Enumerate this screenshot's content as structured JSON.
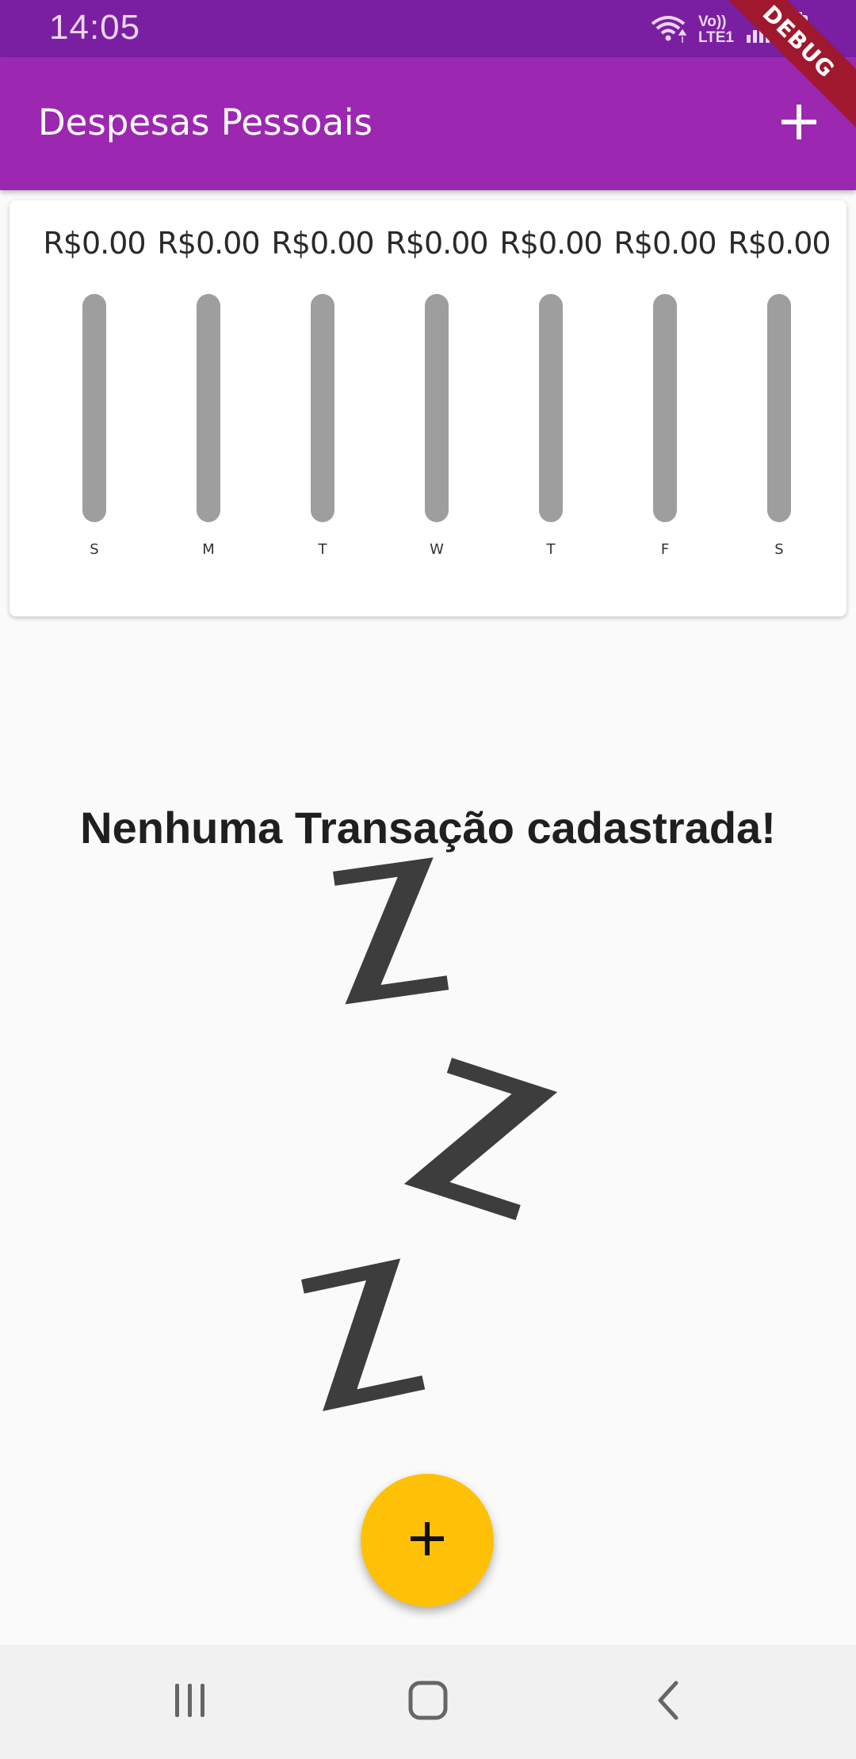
{
  "status_bar": {
    "time": "14:05",
    "network_label": "Vo))\nLTE1",
    "icons": [
      "wifi-icon",
      "signal-icon",
      "battery-charging-icon"
    ]
  },
  "debug_banner": {
    "label": "DEBUG"
  },
  "app_bar": {
    "title": "Despesas Pessoais",
    "add_icon": "plus-icon"
  },
  "chart_data": {
    "type": "bar",
    "categories": [
      "S",
      "M",
      "T",
      "W",
      "T",
      "F",
      "S"
    ],
    "values": [
      0,
      0,
      0,
      0,
      0,
      0,
      0
    ],
    "value_labels": [
      "R$0.00",
      "R$0.00",
      "R$0.00",
      "R$0.00",
      "R$0.00",
      "R$0.00",
      "R$0.00"
    ],
    "title": "",
    "xlabel": "",
    "ylabel": ""
  },
  "empty_state": {
    "message": "Nenhuma Transação cadastrada!",
    "illustration": "zzz-sleep-icon"
  },
  "fab": {
    "icon": "plus-icon"
  },
  "nav_bar": {
    "icons": [
      "recent-apps-icon",
      "home-icon",
      "back-icon"
    ]
  },
  "colors": {
    "primary": "#9c27b0",
    "status_bar": "#7b1fa2",
    "accent": "#ffc107",
    "bar_track": "#9e9e9e",
    "debug_banner": "#a0182d"
  }
}
